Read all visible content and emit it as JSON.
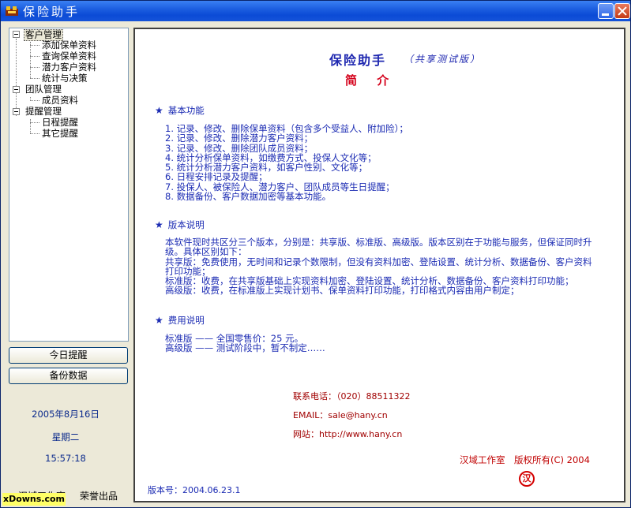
{
  "window": {
    "title": "保险助手"
  },
  "tree": {
    "groups": [
      {
        "label": "客户管理",
        "children": [
          "添加保单资料",
          "查询保单资料",
          "潜力客户资料",
          "统计与决策"
        ]
      },
      {
        "label": "团队管理",
        "children": [
          "成员资料"
        ]
      },
      {
        "label": "提醒管理",
        "children": [
          "日程提醒",
          "其它提醒"
        ]
      }
    ]
  },
  "buttons": {
    "today": "今日提醒",
    "backup": "备份数据"
  },
  "status": {
    "date": "2005年8月16日",
    "weekday": "星期二",
    "time": "15:57:18"
  },
  "bottom_left": {
    "studio": "汉域工作室",
    "made_by": "荣誉出品"
  },
  "watermark": "xDowns.com",
  "content": {
    "title": "保险助手",
    "subtitle": "（共享测试版）",
    "intro": "简 介",
    "features_title": "基本功能",
    "features": [
      "1.  记录、修改、删除保单资料（包含多个受益人、附加险）；",
      "2.  记录、修改、删除潜力客户资料；",
      "3.  记录、修改、删除团队成员资料；",
      "4.  统计分析保单资料，如缴费方式、投保人文化等；",
      "5.  统计分析潜力客户资料，如客户性别、文化等；",
      "6.  日程安排记录及提醒；",
      "7.  投保人、被保险人、潜力客户、团队成员等生日提醒；",
      "8.  数据备份、客户数据加密等基本功能。"
    ],
    "version_title": "版本说明",
    "version_text": [
      "本软件现时共区分三个版本，分别是：共享版、标准版、高级版。版本区别在于功能与服务，但保证同时升级。具体区别如下：",
      "共享版：免费使用，无时间和记录个数限制，但没有资料加密、登陆设置、统计分析、数据备份、客户资料打印功能；",
      "标准版：收费，在共享版基础上实现资料加密、登陆设置、统计分析、数据备份、客户资料打印功能；",
      "高级版：收费，在标准版上实现计划书、保单资料打印功能，打印格式内容由用户制定；"
    ],
    "fee_title": "费用说明",
    "fees": [
      "标准版 —— 全国零售价：25 元。",
      "高级版 —— 测试阶段中，暂不制定……"
    ],
    "contact_phone": "联系电话：（020）88511322",
    "contact_email": "EMAIL：sale@hany.cn",
    "contact_web": "网站：http://www.hany.cn",
    "copyright": "汉域工作室　版权所有(C) 2004",
    "stamp": "汉",
    "version_no": "版本号：2004.06.23.1"
  }
}
